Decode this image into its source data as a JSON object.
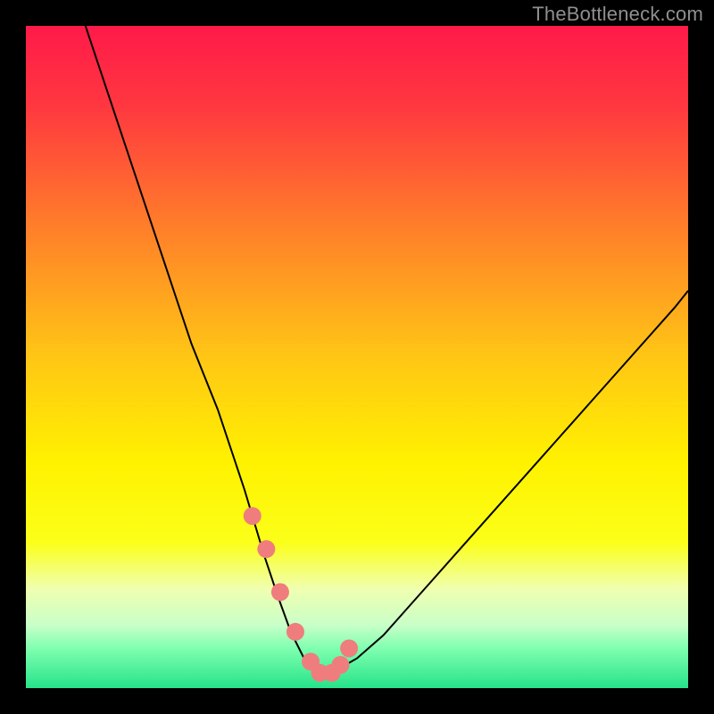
{
  "watermark": "TheBottleneck.com",
  "chart_data": {
    "type": "line",
    "title": "",
    "xlabel": "",
    "ylabel": "",
    "xlim": [
      0,
      100
    ],
    "ylim": [
      0,
      100
    ],
    "grid": false,
    "legend": false,
    "gradient_stops": [
      {
        "offset": 0.0,
        "color": "#ff1a49"
      },
      {
        "offset": 0.12,
        "color": "#ff3740"
      },
      {
        "offset": 0.3,
        "color": "#ff7d2a"
      },
      {
        "offset": 0.5,
        "color": "#ffc615"
      },
      {
        "offset": 0.66,
        "color": "#fff200"
      },
      {
        "offset": 0.78,
        "color": "#fbff19"
      },
      {
        "offset": 0.85,
        "color": "#f0ffb0"
      },
      {
        "offset": 0.905,
        "color": "#c8ffc8"
      },
      {
        "offset": 0.94,
        "color": "#7fffaf"
      },
      {
        "offset": 1.0,
        "color": "#26e38a"
      }
    ],
    "series": [
      {
        "name": "bottleneck-curve",
        "color": "#000000",
        "width": 2,
        "x": [
          9,
          11,
          13,
          15,
          17,
          19,
          21,
          23,
          25,
          27,
          29,
          31,
          33,
          34.5,
          36,
          38,
          40,
          42,
          44,
          46.5,
          50,
          54,
          58,
          62,
          66,
          70,
          74,
          78,
          82,
          86,
          90,
          94,
          98,
          100
        ],
        "y": [
          100,
          94,
          88,
          82,
          76,
          70,
          64,
          58,
          52,
          47,
          42,
          36,
          30,
          25,
          20,
          14,
          8.5,
          4.5,
          2.5,
          2.5,
          4.5,
          8,
          12.5,
          17,
          21.5,
          26,
          30.5,
          35,
          39.5,
          44,
          48.5,
          53,
          57.5,
          60
        ]
      },
      {
        "name": "bottom-markers",
        "color": "#ef7d7d",
        "marker_radius": 10,
        "x": [
          34.2,
          36.3,
          38.4,
          40.7,
          43.0,
          44.4,
          46.2,
          47.5,
          48.8
        ],
        "y": [
          26,
          21,
          14.5,
          8.5,
          4.0,
          2.3,
          2.3,
          3.5,
          6.0
        ]
      }
    ]
  }
}
